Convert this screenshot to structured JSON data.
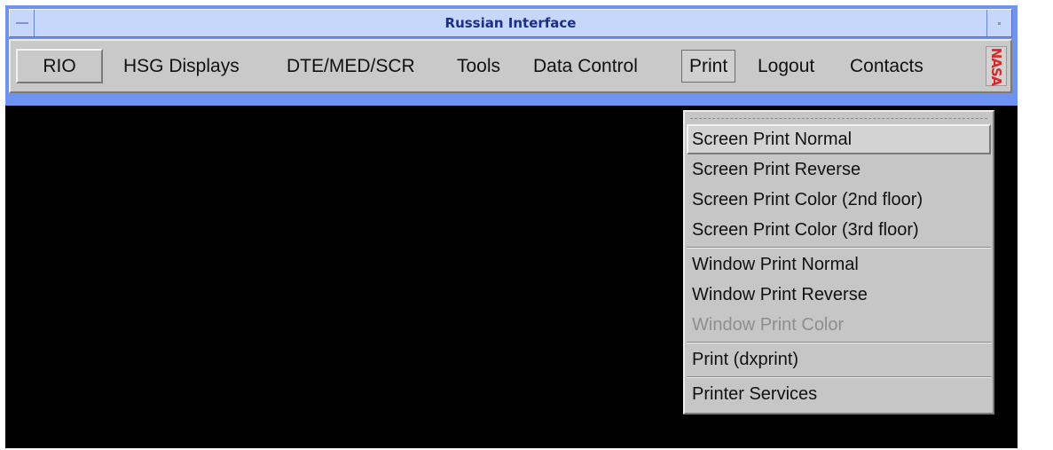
{
  "window": {
    "title": "Russian Interface"
  },
  "menubar": {
    "items": [
      {
        "id": "rio",
        "label": "RIO"
      },
      {
        "id": "hsg_displays",
        "label": "HSG Displays"
      },
      {
        "id": "dte_med_scr",
        "label": "DTE/MED/SCR"
      },
      {
        "id": "tools",
        "label": "Tools"
      },
      {
        "id": "data_control",
        "label": "Data Control"
      },
      {
        "id": "print",
        "label": "Print",
        "open": true
      },
      {
        "id": "logout",
        "label": "Logout"
      },
      {
        "id": "contacts",
        "label": "Contacts"
      }
    ],
    "logo": {
      "text": "NASA",
      "icon": "nasa-worm-logo",
      "color": "#d42a2a"
    }
  },
  "print_menu": {
    "items": [
      {
        "label": "Screen Print Normal",
        "state": "highlighted"
      },
      {
        "label": "Screen Print Reverse",
        "state": "enabled"
      },
      {
        "label": "Screen Print Color (2nd floor)",
        "state": "enabled"
      },
      {
        "label": "Screen Print Color (3rd floor)",
        "state": "enabled"
      },
      {
        "label": "Window Print Normal",
        "state": "enabled"
      },
      {
        "label": "Window Print Reverse",
        "state": "enabled"
      },
      {
        "label": "Window Print Color",
        "state": "disabled"
      },
      {
        "label": "Print (dxprint)",
        "state": "enabled"
      },
      {
        "label": "Printer Services",
        "state": "enabled"
      }
    ]
  },
  "colors": {
    "window_frame": "#6f93f2",
    "title_text": "#1a2f86",
    "menu_background": "#c9c9c9",
    "desktop": "#000000",
    "disabled_text": "#8e8e8e"
  }
}
